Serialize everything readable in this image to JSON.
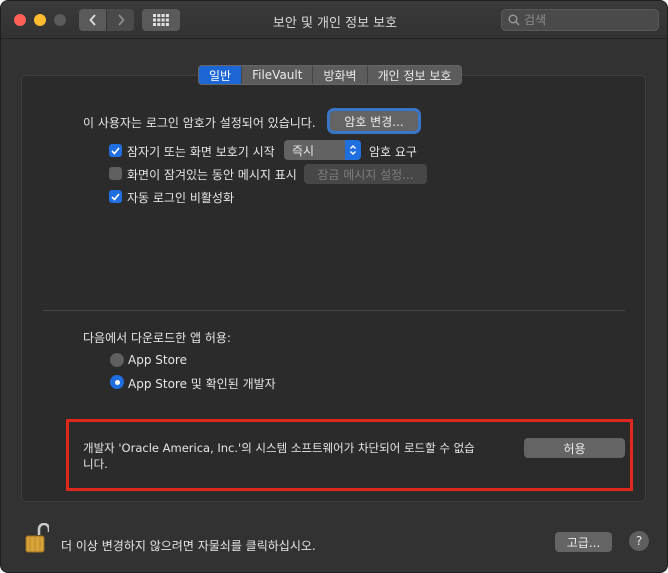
{
  "window": {
    "title": "보안 및 개인 정보 보호",
    "search_placeholder": "검색"
  },
  "tabs": [
    {
      "label": "일반",
      "active": true
    },
    {
      "label": "FileVault",
      "active": false
    },
    {
      "label": "방화벽",
      "active": false
    },
    {
      "label": "개인 정보 보호",
      "active": false
    }
  ],
  "general": {
    "password_set_text": "이 사용자는 로그인 암호가 설정되어 있습니다.",
    "change_password_button": "암호 변경...",
    "require_password": {
      "label": "잠자기 또는 화면 보호기 시작",
      "checked": true,
      "select_value": "즉시",
      "suffix": "암호 요구"
    },
    "show_message": {
      "label": "화면이 잠겨있는 동안 메시지 표시",
      "checked": false,
      "button": "잠금 메시지 설정..."
    },
    "disable_autologin": {
      "label": "자동 로그인 비활성화",
      "checked": true
    }
  },
  "downloads": {
    "heading": "다음에서 다운로드한 앱 허용:",
    "options": [
      {
        "label": "App Store",
        "selected": false
      },
      {
        "label": "App Store 및 확인된 개발자",
        "selected": true
      }
    ]
  },
  "blocked": {
    "message_line1": "개발자 'Oracle America, Inc.'의 시스템 소프트웨어가 차단되어 로드할 수 없습",
    "message_line2": "니다.",
    "allow_button": "허용"
  },
  "footer": {
    "lock_text": "더 이상 변경하지 않으려면 자물쇠를 클릭하십시오.",
    "advanced_button": "고급...",
    "help_label": "?"
  },
  "colors": {
    "accent": "#1f6fe0",
    "highlight_border": "#e0281f"
  }
}
